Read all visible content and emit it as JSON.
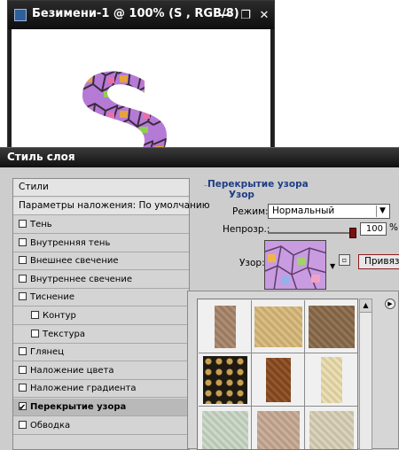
{
  "document_window": {
    "title": "Безимени-1 @ 100% (S , RGB/8)",
    "buttons": {
      "minimize": "—",
      "restore": "❐",
      "close": "✕"
    }
  },
  "dialog": {
    "title": "Стиль слоя",
    "styles_header": "Стили",
    "blending_options": "Параметры наложения: По умолчанию",
    "style_items": [
      {
        "label": "Тень",
        "checked": false
      },
      {
        "label": "Внутренняя тень",
        "checked": false
      },
      {
        "label": "Внешнее свечение",
        "checked": false
      },
      {
        "label": "Внутреннее свечение",
        "checked": false
      },
      {
        "label": "Тиснение",
        "checked": false
      },
      {
        "label": "Контур",
        "checked": false
      },
      {
        "label": "Текстура",
        "checked": false
      },
      {
        "label": "Глянец",
        "checked": false
      },
      {
        "label": "Наложение цвета",
        "checked": false
      },
      {
        "label": "Наложение градиента",
        "checked": false
      },
      {
        "label": "Перекрытие узора",
        "checked": true
      },
      {
        "label": "Обводка",
        "checked": false
      }
    ],
    "panel": {
      "section_title": "Перекрытие узора",
      "subsection_title": "Узор",
      "mode_label": "Режим:",
      "mode_value": "Нормальный",
      "opacity_label": "Непрозр.:",
      "opacity_value": "100",
      "opacity_unit": "%",
      "opacity_level": 1.0,
      "pattern_label": "Узор:",
      "snap_button": "Привязать к исходной точке"
    },
    "picker": {
      "swatch_names": [
        "brown-linen",
        "gold-damask",
        "dark-brown-damask",
        "black-gold-ornament",
        "copper-texture",
        "cream-damask",
        "mint-damask",
        "beige-ornament",
        "ivory-damask"
      ]
    }
  },
  "colors": {
    "dark_title": "#111111",
    "dialog_bg": "#cdcdcd",
    "section_title": "#1e3d85",
    "accent_red": "#8b1a1a"
  }
}
